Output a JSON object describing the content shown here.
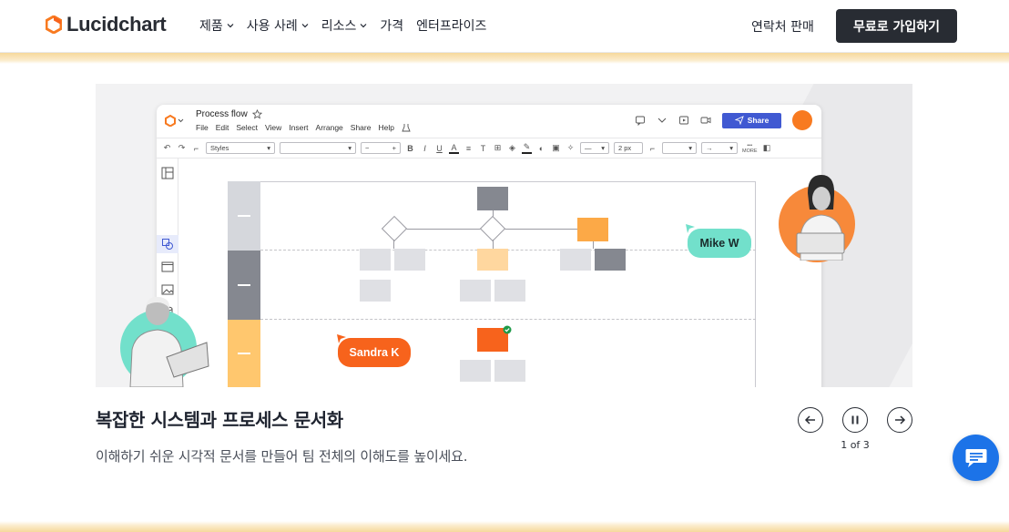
{
  "nav": {
    "brand": "Lucidchart",
    "links": [
      {
        "label": "제품",
        "has_dropdown": true
      },
      {
        "label": "사용 사례",
        "has_dropdown": true
      },
      {
        "label": "리소스",
        "has_dropdown": true
      },
      {
        "label": "가격",
        "has_dropdown": false
      },
      {
        "label": "엔터프라이즈",
        "has_dropdown": false
      }
    ],
    "contact_sales": "연락처 판매",
    "signup": "무료로 가입하기"
  },
  "app": {
    "doc_title": "Process flow",
    "menu": [
      "File",
      "Edit",
      "Select",
      "View",
      "Insert",
      "Arrange",
      "Share",
      "Help"
    ],
    "share_label": "Share",
    "toolbar": {
      "styles_label": "Styles",
      "font_size": "2 px",
      "more_label": "MORE"
    }
  },
  "diagram": {
    "collaborators": [
      {
        "name": "Mike W",
        "color": "#72e0cb"
      },
      {
        "name": "Sandra K",
        "color": "#f7631c"
      }
    ]
  },
  "carousel": {
    "title": "복잡한 시스템과 프로세스 문서화",
    "description": "이해하기 쉬운 시각적 문서를 만들어 팀 전체의 이해도를 높이세요.",
    "counter": "1 of 3"
  },
  "colors": {
    "brand_orange": "#f87a20",
    "nav_button": "#282c33",
    "share_blue": "#4059d2",
    "chat_blue": "#1c73e8"
  },
  "icons": [
    "lucid-logo-icon",
    "chevron-down-icon",
    "arrow-left-icon",
    "pause-icon",
    "arrow-right-icon",
    "chat-icon"
  ]
}
